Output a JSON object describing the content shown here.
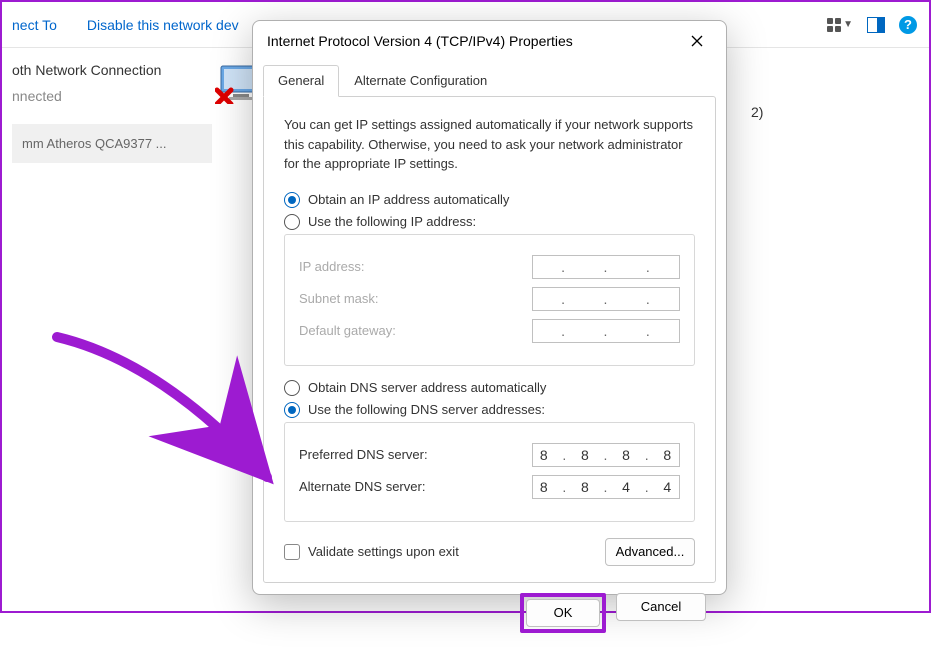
{
  "bg": {
    "connect_to": "nect To",
    "disable_device": "Disable this network dev",
    "adapter_name": "oth Network Connection",
    "status": "nnected",
    "card_text": "mm Atheros QCA9377 ...",
    "count_2": "2)"
  },
  "dialog": {
    "title": "Internet Protocol Version 4 (TCP/IPv4) Properties",
    "tabs": {
      "general": "General",
      "alternate": "Alternate Configuration"
    },
    "intro": "You can get IP settings assigned automatically if your network supports this capability. Otherwise, you need to ask your network administrator for the appropriate IP settings.",
    "ip": {
      "auto_label": "Obtain an IP address automatically",
      "manual_label": "Use the following IP address:",
      "ip_address_label": "IP address:",
      "subnet_label": "Subnet mask:",
      "gateway_label": "Default gateway:"
    },
    "dns": {
      "auto_label": "Obtain DNS server address automatically",
      "manual_label": "Use the following DNS server addresses:",
      "preferred_label": "Preferred DNS server:",
      "alternate_label": "Alternate DNS server:",
      "preferred_value": [
        "8",
        "8",
        "8",
        "8"
      ],
      "alternate_value": [
        "8",
        "8",
        "4",
        "4"
      ]
    },
    "validate_label": "Validate settings upon exit",
    "advanced_label": "Advanced...",
    "ok_label": "OK",
    "cancel_label": "Cancel"
  }
}
